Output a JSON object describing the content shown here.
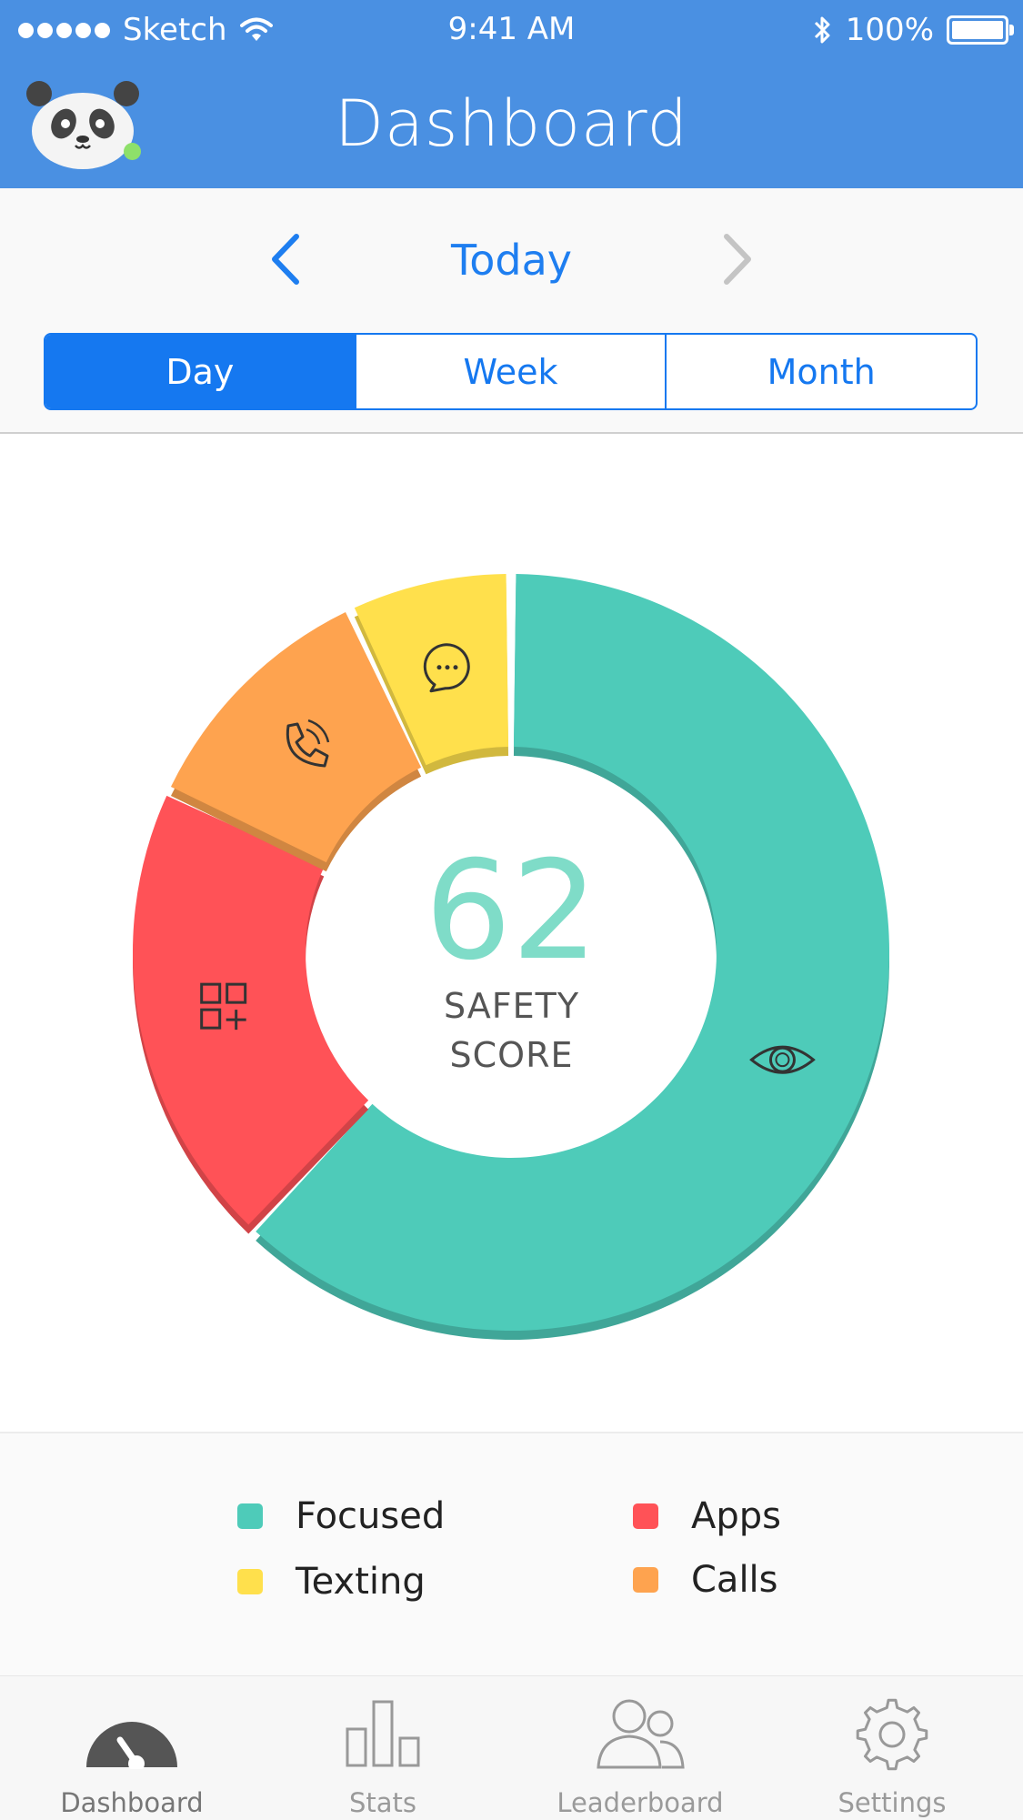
{
  "status_bar": {
    "carrier": "Sketch",
    "time": "9:41 AM",
    "battery": "100%"
  },
  "header": {
    "title": "Dashboard"
  },
  "date_nav": {
    "label": "Today"
  },
  "segments": [
    {
      "label": "Day",
      "active": true
    },
    {
      "label": "Week",
      "active": false
    },
    {
      "label": "Month",
      "active": false
    }
  ],
  "score": {
    "value": "62",
    "label_line1": "SAFETY",
    "label_line2": "SCORE"
  },
  "chart_data": {
    "type": "pie",
    "categories": [
      "Focused",
      "Apps",
      "Calls",
      "Texting"
    ],
    "values": [
      62,
      20,
      11,
      7
    ],
    "colors": [
      "#4ecbb9",
      "#ff5257",
      "#fea34f",
      "#ffe04c"
    ],
    "icons": [
      "eye-icon",
      "apps-icon",
      "phone-icon",
      "chat-icon"
    ]
  },
  "legend": [
    {
      "label": "Focused",
      "color": "#4ecbb9"
    },
    {
      "label": "Apps",
      "color": "#ff5257"
    },
    {
      "label": "Texting",
      "color": "#ffe04c"
    },
    {
      "label": "Calls",
      "color": "#fea34f"
    }
  ],
  "tabs": [
    {
      "label": "Dashboard",
      "icon": "gauge-icon",
      "active": true
    },
    {
      "label": "Stats",
      "icon": "bar-chart-icon",
      "active": false
    },
    {
      "label": "Leaderboard",
      "icon": "people-icon",
      "active": false
    },
    {
      "label": "Settings",
      "icon": "gear-icon",
      "active": false
    }
  ]
}
